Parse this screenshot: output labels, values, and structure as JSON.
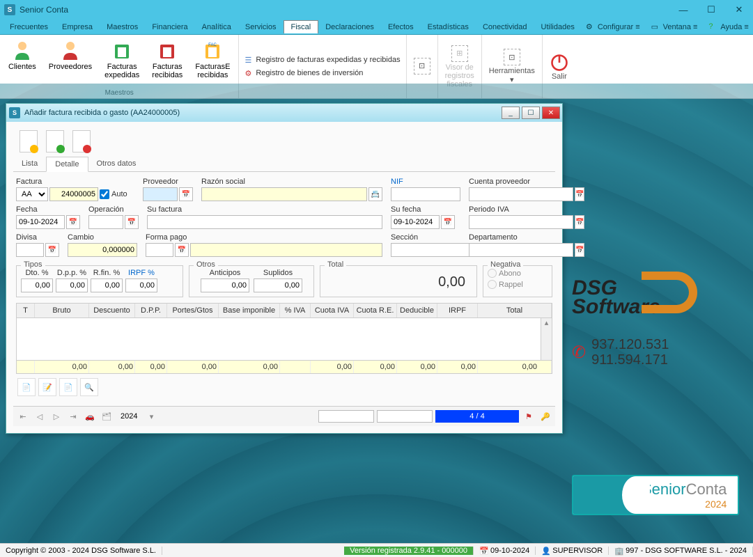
{
  "app": {
    "title": "Senior Conta"
  },
  "menu": {
    "items": [
      "Frecuentes",
      "Empresa",
      "Maestros",
      "Financiera",
      "Analítica",
      "Servicios",
      "Fiscal",
      "Declaraciones",
      "Efectos",
      "Estadísticas",
      "Conectividad",
      "Utilidades"
    ],
    "active": "Fiscal",
    "right": {
      "configurar": "Configurar",
      "ventana": "Ventana",
      "ayuda": "Ayuda"
    }
  },
  "ribbon": {
    "maestros": {
      "label": "Maestros",
      "clientes": "Clientes",
      "proveedores": "Proveedores",
      "expedidas": "Facturas\nexpedidas",
      "recibidas": "Facturas\nrecibidas",
      "erecibidas": "FacturasE\nrecibidas"
    },
    "links": {
      "registro_fact": "Registro de facturas expedidas y recibidas",
      "registro_bienes": "Registro de bienes de inversión"
    },
    "visor": "Visor de\nregistros\nfiscales",
    "herramientas": "Herramientas",
    "salir": "Salir"
  },
  "dialog": {
    "title": "Añadir factura recibida o gasto (AA24000005)",
    "tabs": {
      "lista": "Lista",
      "detalle": "Detalle",
      "otros": "Otros datos"
    },
    "labels": {
      "factura": "Factura",
      "auto": "Auto",
      "proveedor": "Proveedor",
      "razon": "Razón social",
      "nif": "NIF",
      "cuenta": "Cuenta proveedor",
      "fecha": "Fecha",
      "operacion": "Operación",
      "sufactura": "Su factura",
      "sufecha": "Su fecha",
      "periodo": "Periodo IVA",
      "divisa": "Divisa",
      "cambio": "Cambio",
      "formapago": "Forma pago",
      "seccion": "Sección",
      "departamento": "Departamento",
      "tipos": "Tipos",
      "dto": "Dto. %",
      "dpp": "D.p.p. %",
      "rfin": "R.fin. %",
      "irpf": "IRPF %",
      "otros": "Otros",
      "anticipos": "Anticipos",
      "suplidos": "Suplidos",
      "total": "Total",
      "negativa": "Negativa",
      "abono": "Abono",
      "rappel": "Rappel"
    },
    "values": {
      "serie": "AA",
      "numero": "24000005",
      "auto": true,
      "fecha": "09-10-2024",
      "sufecha": "09-10-2024",
      "cambio": "0,000000",
      "dto": "0,00",
      "dpp": "0,00",
      "rfin": "0,00",
      "irpf": "0,00",
      "anticipos": "0,00",
      "suplidos": "0,00",
      "total": "0,00"
    },
    "grid": {
      "cols": [
        "T",
        "Bruto",
        "Descuento",
        "D.P.P.",
        "Portes/Gtos",
        "Base imponible",
        "% IVA",
        "Cuota IVA",
        "Cuota R.E.",
        "Deducible",
        "IRPF",
        "Total"
      ],
      "totals": [
        "",
        "0,00",
        "0,00",
        "0,00",
        "0,00",
        "0,00",
        "",
        "0,00",
        "0,00",
        "0,00",
        "0,00",
        "0,00"
      ]
    },
    "nav": {
      "year": "2024",
      "pager": "4 / 4"
    }
  },
  "brand": {
    "dsg1": "DSG",
    "dsg2": "Software",
    "phone1": "937.120.531",
    "phone2": "911.594.171"
  },
  "badge": {
    "senior": "Senior",
    "conta": "Conta",
    "year": "2024"
  },
  "status": {
    "copyright": "Copyright © 2003 - 2024 DSG Software S.L.",
    "version": "Versión registrada 2.9.41 - 000000",
    "date": "09-10-2024",
    "user": "SUPERVISOR",
    "company": "997  - DSG SOFTWARE S.L. - 2024"
  }
}
